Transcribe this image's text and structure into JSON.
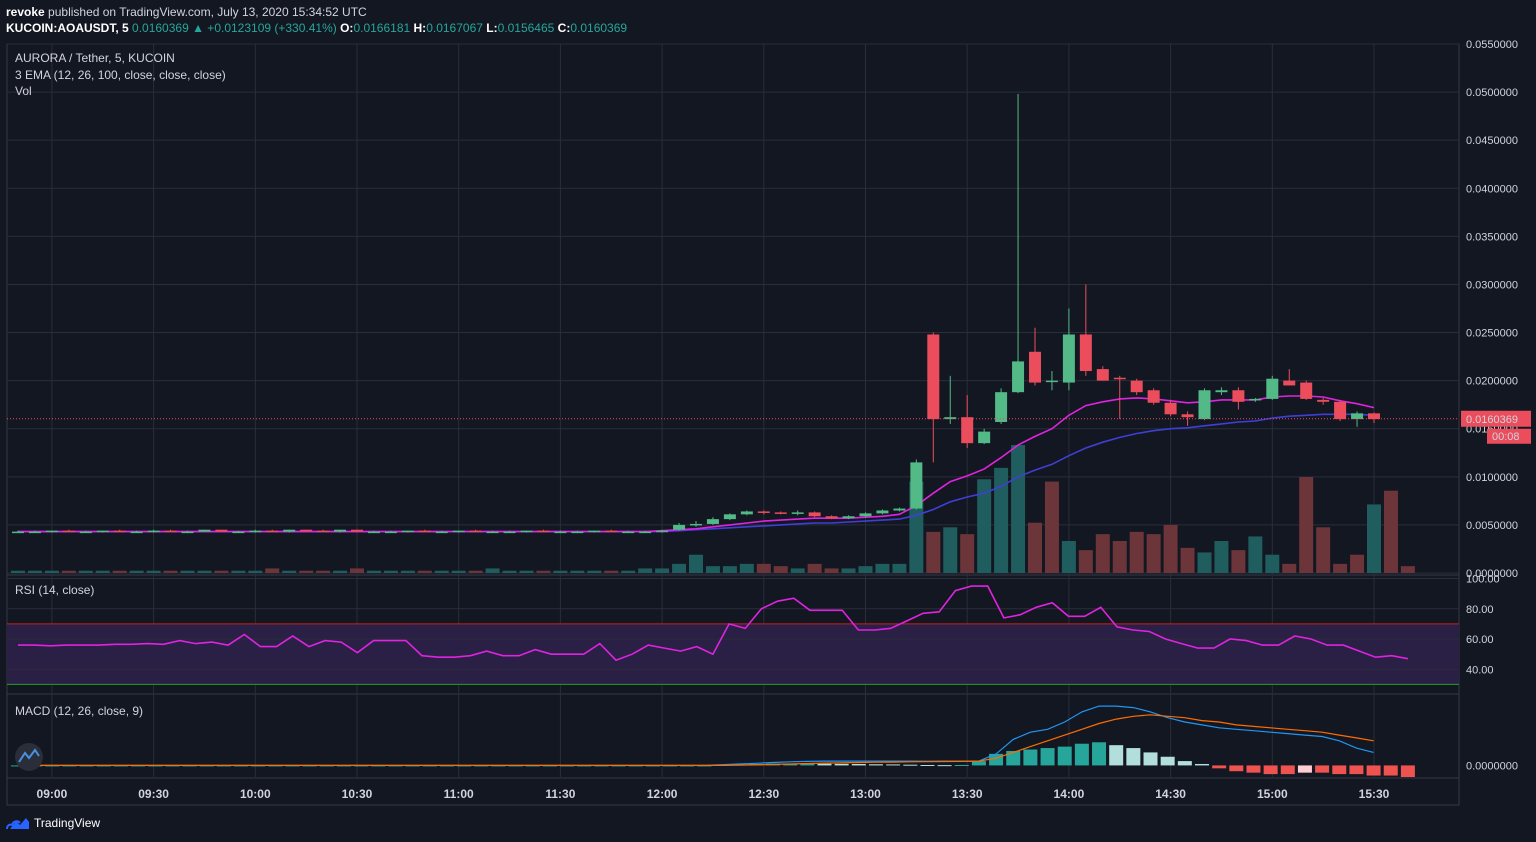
{
  "header": {
    "author": "revoke",
    "published_text": "published on TradingView.com, July 13, 2020 15:34:52 UTC",
    "symbol": "KUCOIN:AOAUSDT, 5",
    "last": "0.0160369",
    "change": "▲ +0.0123109 (+330.41%)",
    "o_label": "O:",
    "o_value": "0.0166181",
    "h_label": "H:",
    "h_value": "0.0167067",
    "l_label": "L:",
    "l_value": "0.0156465",
    "c_label": "C:",
    "c_value": "0.0160369"
  },
  "price_pane": {
    "title": "AURORA / Tether, 5, KUCOIN",
    "ema_label": "3 EMA (12, 26, 100, close, close, close)",
    "vol_label": "Vol",
    "price_tag": "0.0160369",
    "countdown": "00:08"
  },
  "rsi_pane": {
    "label": "RSI (14, close)"
  },
  "macd_pane": {
    "label": "MACD (12, 26, close, 9)"
  },
  "footer": {
    "brand": "TradingView"
  },
  "colors": {
    "up": "#53b987",
    "down": "#eb4d5c",
    "vol_up": "#1f5d5e",
    "vol_down": "#6c3539",
    "ema_fast": "#e023e0",
    "ema_slow": "#3f3fd6",
    "rsi": "#e023e0",
    "macd": "#2196f3",
    "signal": "#ff6d00"
  },
  "chart_data": [
    {
      "type": "candlestick",
      "ylim": [
        0,
        0.055
      ],
      "y_ticks": [
        "0.0550000",
        "0.0500000",
        "0.0450000",
        "0.0400000",
        "0.0350000",
        "0.0300000",
        "0.0250000",
        "0.0200000",
        "0.0150000",
        "0.0100000",
        "0.0050000",
        "0.0000000"
      ],
      "y_tick_values": [
        0.055,
        0.05,
        0.045,
        0.04,
        0.035,
        0.03,
        0.025,
        0.02,
        0.015,
        0.01,
        0.005,
        0
      ],
      "x_ticks": [
        "09:00",
        "09:30",
        "10:00",
        "10:30",
        "11:00",
        "11:30",
        "12:00",
        "12:30",
        "13:00",
        "13:30",
        "14:00",
        "14:30",
        "15:00",
        "15:30"
      ],
      "x_tick_index": [
        2,
        8,
        14,
        20,
        26,
        32,
        38,
        44,
        50,
        56,
        62,
        68,
        74,
        80
      ],
      "ohlc": [
        [
          0.0043,
          0.0044,
          0.0042,
          0.0043
        ],
        [
          0.0043,
          0.0044,
          0.0042,
          0.0043
        ],
        [
          0.0043,
          0.0044,
          0.0042,
          0.0044
        ],
        [
          0.0044,
          0.0045,
          0.0043,
          0.0043
        ],
        [
          0.0043,
          0.0044,
          0.0042,
          0.0043
        ],
        [
          0.0043,
          0.0044,
          0.0042,
          0.0044
        ],
        [
          0.0044,
          0.0045,
          0.0043,
          0.0043
        ],
        [
          0.0043,
          0.0044,
          0.0042,
          0.0043
        ],
        [
          0.0043,
          0.0045,
          0.0042,
          0.0044
        ],
        [
          0.0044,
          0.0045,
          0.0043,
          0.0043
        ],
        [
          0.0043,
          0.0044,
          0.0042,
          0.0043
        ],
        [
          0.0043,
          0.0045,
          0.0043,
          0.0045
        ],
        [
          0.0045,
          0.0045,
          0.0043,
          0.0043
        ],
        [
          0.0043,
          0.0044,
          0.0042,
          0.0043
        ],
        [
          0.0043,
          0.0045,
          0.0042,
          0.0044
        ],
        [
          0.0044,
          0.0045,
          0.0043,
          0.0043
        ],
        [
          0.0043,
          0.0045,
          0.0042,
          0.0045
        ],
        [
          0.0045,
          0.0045,
          0.0043,
          0.0044
        ],
        [
          0.0044,
          0.0045,
          0.0043,
          0.0043
        ],
        [
          0.0043,
          0.0045,
          0.0042,
          0.0045
        ],
        [
          0.0045,
          0.0045,
          0.0043,
          0.0043
        ],
        [
          0.0043,
          0.0044,
          0.0042,
          0.0043
        ],
        [
          0.0043,
          0.0044,
          0.0042,
          0.0043
        ],
        [
          0.0043,
          0.0044,
          0.0042,
          0.0044
        ],
        [
          0.0044,
          0.0045,
          0.0043,
          0.0043
        ],
        [
          0.0043,
          0.0044,
          0.0042,
          0.0043
        ],
        [
          0.0043,
          0.0044,
          0.0042,
          0.0044
        ],
        [
          0.0044,
          0.0045,
          0.0043,
          0.0043
        ],
        [
          0.0043,
          0.0044,
          0.0042,
          0.0043
        ],
        [
          0.0043,
          0.0044,
          0.0042,
          0.0043
        ],
        [
          0.0043,
          0.0044,
          0.0042,
          0.0044
        ],
        [
          0.0044,
          0.0045,
          0.0043,
          0.0043
        ],
        [
          0.0043,
          0.0044,
          0.0042,
          0.0043
        ],
        [
          0.0043,
          0.0044,
          0.0042,
          0.0043
        ],
        [
          0.0043,
          0.0044,
          0.0042,
          0.0044
        ],
        [
          0.0044,
          0.0045,
          0.0043,
          0.0043
        ],
        [
          0.0043,
          0.0044,
          0.0042,
          0.0043
        ],
        [
          0.0043,
          0.0044,
          0.0042,
          0.0043
        ],
        [
          0.0043,
          0.0045,
          0.0042,
          0.0044
        ],
        [
          0.0045,
          0.0052,
          0.0044,
          0.005
        ],
        [
          0.005,
          0.0054,
          0.0048,
          0.0051
        ],
        [
          0.0051,
          0.0058,
          0.005,
          0.0056
        ],
        [
          0.0056,
          0.0062,
          0.0055,
          0.0061
        ],
        [
          0.0061,
          0.0065,
          0.006,
          0.0064
        ],
        [
          0.0064,
          0.0065,
          0.0061,
          0.0063
        ],
        [
          0.0063,
          0.0064,
          0.0061,
          0.0062
        ],
        [
          0.0062,
          0.0065,
          0.006,
          0.0063
        ],
        [
          0.0063,
          0.0064,
          0.0058,
          0.0059
        ],
        [
          0.0059,
          0.006,
          0.0056,
          0.0057
        ],
        [
          0.0057,
          0.006,
          0.0056,
          0.0059
        ],
        [
          0.0059,
          0.0063,
          0.0058,
          0.0062
        ],
        [
          0.0062,
          0.0066,
          0.0061,
          0.0065
        ],
        [
          0.0065,
          0.0068,
          0.0064,
          0.0067
        ],
        [
          0.0067,
          0.0118,
          0.0066,
          0.0115
        ],
        [
          0.0248,
          0.025,
          0.0115,
          0.016
        ],
        [
          0.016,
          0.0205,
          0.0155,
          0.0162
        ],
        [
          0.0162,
          0.0185,
          0.013,
          0.0135
        ],
        [
          0.0135,
          0.015,
          0.0134,
          0.0147
        ],
        [
          0.0157,
          0.0192,
          0.0155,
          0.0188
        ],
        [
          0.0188,
          0.0498,
          0.0187,
          0.022
        ],
        [
          0.023,
          0.0255,
          0.0195,
          0.0198
        ],
        [
          0.02,
          0.021,
          0.019,
          0.02
        ],
        [
          0.0198,
          0.0275,
          0.019,
          0.0248
        ],
        [
          0.0248,
          0.03,
          0.0205,
          0.021
        ],
        [
          0.0212,
          0.0215,
          0.02,
          0.02
        ],
        [
          0.0203,
          0.0205,
          0.016,
          0.0202
        ],
        [
          0.02,
          0.0202,
          0.0185,
          0.0188
        ],
        [
          0.019,
          0.0192,
          0.0175,
          0.0177
        ],
        [
          0.0177,
          0.018,
          0.0163,
          0.0165
        ],
        [
          0.0165,
          0.0168,
          0.0153,
          0.0162
        ],
        [
          0.016,
          0.0192,
          0.0159,
          0.019
        ],
        [
          0.0188,
          0.0193,
          0.0185,
          0.019
        ],
        [
          0.019,
          0.0193,
          0.017,
          0.0178
        ],
        [
          0.018,
          0.0182,
          0.0178,
          0.0181
        ],
        [
          0.0181,
          0.0205,
          0.018,
          0.0202
        ],
        [
          0.02,
          0.0212,
          0.0195,
          0.0195
        ],
        [
          0.0198,
          0.02,
          0.018,
          0.0181
        ],
        [
          0.018,
          0.0182,
          0.0175,
          0.0178
        ],
        [
          0.0178,
          0.018,
          0.0158,
          0.016
        ],
        [
          0.016,
          0.0168,
          0.0152,
          0.0166
        ],
        [
          0.0166,
          0.0167,
          0.0156,
          0.016
        ]
      ],
      "ema_fast": [
        0.0043,
        0.0043,
        0.0043,
        0.0043,
        0.0043,
        0.0043,
        0.0043,
        0.0043,
        0.0043,
        0.0043,
        0.0043,
        0.0043,
        0.0043,
        0.0043,
        0.0043,
        0.0043,
        0.0043,
        0.0043,
        0.0043,
        0.0043,
        0.0043,
        0.0043,
        0.0043,
        0.0043,
        0.0043,
        0.0043,
        0.0043,
        0.0043,
        0.0043,
        0.0043,
        0.0043,
        0.0043,
        0.0043,
        0.0043,
        0.0043,
        0.0043,
        0.0043,
        0.0043,
        0.0044,
        0.0045,
        0.0046,
        0.0048,
        0.005,
        0.0052,
        0.0054,
        0.0055,
        0.0056,
        0.0057,
        0.0057,
        0.0057,
        0.0058,
        0.0059,
        0.0061,
        0.007,
        0.0083,
        0.0095,
        0.0101,
        0.0108,
        0.012,
        0.0133,
        0.0142,
        0.015,
        0.0164,
        0.0174,
        0.0178,
        0.0181,
        0.0182,
        0.0181,
        0.0179,
        0.0177,
        0.0178,
        0.018,
        0.018,
        0.018,
        0.0183,
        0.0184,
        0.0184,
        0.0183,
        0.0179,
        0.0176,
        0.0172
      ],
      "ema_slow": [
        0.0043,
        0.0043,
        0.0043,
        0.0043,
        0.0043,
        0.0043,
        0.0043,
        0.0043,
        0.0043,
        0.0043,
        0.0043,
        0.0043,
        0.0043,
        0.0043,
        0.0043,
        0.0043,
        0.0043,
        0.0043,
        0.0043,
        0.0043,
        0.0043,
        0.0043,
        0.0043,
        0.0043,
        0.0043,
        0.0043,
        0.0043,
        0.0043,
        0.0043,
        0.0043,
        0.0043,
        0.0043,
        0.0043,
        0.0043,
        0.0043,
        0.0043,
        0.0043,
        0.0043,
        0.0043,
        0.0044,
        0.0045,
        0.0046,
        0.0047,
        0.0048,
        0.0049,
        0.005,
        0.0051,
        0.0052,
        0.0052,
        0.0053,
        0.0054,
        0.0055,
        0.0056,
        0.006,
        0.0066,
        0.0074,
        0.0079,
        0.0083,
        0.009,
        0.01,
        0.0107,
        0.0113,
        0.0122,
        0.013,
        0.0136,
        0.0141,
        0.0145,
        0.0148,
        0.015,
        0.0151,
        0.0153,
        0.0155,
        0.0157,
        0.0158,
        0.0161,
        0.0163,
        0.0164,
        0.0165,
        0.0165,
        0.0165,
        0.0164
      ],
      "volume": [
        1,
        1,
        1,
        1,
        1,
        1,
        1,
        1,
        1,
        1,
        1,
        1,
        1,
        1,
        1,
        2,
        1,
        1,
        1,
        1,
        2,
        1,
        1,
        1,
        1,
        1,
        1,
        1,
        2,
        1,
        1,
        1,
        1,
        1,
        1,
        1,
        1,
        2,
        2,
        4,
        8,
        3,
        3,
        4,
        4,
        3,
        2,
        4,
        2,
        2,
        3,
        4,
        4,
        40,
        18,
        20,
        17,
        41,
        46,
        56,
        22,
        40,
        14,
        10,
        17,
        14,
        18,
        17,
        21,
        11,
        9,
        14,
        10,
        16,
        8,
        4,
        42,
        20,
        4,
        8,
        30,
        36,
        3
      ],
      "volume_up": [
        true,
        true,
        true,
        false,
        true,
        true,
        false,
        true,
        true,
        false,
        true,
        true,
        false,
        true,
        true,
        false,
        true,
        false,
        false,
        true,
        false,
        true,
        true,
        true,
        false,
        true,
        true,
        false,
        true,
        true,
        true,
        false,
        true,
        true,
        true,
        false,
        true,
        true,
        true,
        true,
        true,
        true,
        true,
        true,
        false,
        false,
        true,
        false,
        false,
        true,
        true,
        true,
        true,
        true,
        false,
        true,
        false,
        true,
        true,
        true,
        false,
        false,
        true,
        false,
        false,
        false,
        false,
        false,
        false,
        false,
        true,
        true,
        false,
        true,
        true,
        false,
        false,
        false,
        false,
        false,
        true,
        false
      ]
    },
    {
      "type": "line",
      "name": "RSI (14, close)",
      "ylim": [
        25,
        101
      ],
      "y_ticks": [
        "100.00",
        "80.00",
        "60.00",
        "40.00"
      ],
      "y_tick_values": [
        100,
        80,
        60,
        40
      ],
      "bands": [
        30,
        70
      ],
      "values": [
        56,
        56,
        55.5,
        56,
        56,
        56,
        56.5,
        56.5,
        57,
        56.5,
        59,
        57,
        58,
        56,
        63,
        55,
        55,
        62,
        55,
        59,
        58,
        51,
        59,
        59,
        59,
        49,
        48,
        48,
        49,
        52,
        49,
        49,
        53,
        50,
        50,
        50,
        57,
        46,
        50,
        56,
        54,
        52,
        55,
        50,
        70,
        67,
        80,
        85,
        87,
        79,
        79,
        79,
        66,
        66,
        67,
        72,
        77,
        78,
        92,
        95,
        95,
        74,
        76,
        81,
        84,
        75,
        75,
        81,
        68,
        66,
        65,
        60,
        57,
        54,
        54,
        60,
        59,
        56,
        56,
        62,
        60,
        56,
        56,
        52,
        48,
        49,
        47
      ]
    },
    {
      "type": "line",
      "name": "MACD (12, 26, close, 9)",
      "ylim": [
        -0.0008,
        0.0048
      ],
      "y_ticks": [
        "0.0000000"
      ],
      "y_tick_values": [
        0
      ],
      "macd": [
        0,
        0,
        0,
        0,
        0,
        0,
        0,
        0,
        0,
        0,
        0,
        0,
        0,
        0,
        0,
        0,
        0,
        0,
        0,
        0,
        0,
        0,
        0,
        0,
        0,
        0,
        0,
        0,
        0,
        0,
        0,
        0,
        0,
        0,
        0,
        0,
        0,
        0,
        0,
        0,
        0,
        5e-05,
        0.0001,
        0.00015,
        0.0002,
        0.00025,
        0.00028,
        0.0003,
        0.0003,
        0.0003,
        0.0003,
        0.0003,
        0.0003,
        0.00029,
        0.0003,
        0.0003,
        0.0003,
        0.0008,
        0.0018,
        0.0023,
        0.0025,
        0.003,
        0.0037,
        0.0041,
        0.0041,
        0.004,
        0.0037,
        0.0033,
        0.003,
        0.0028,
        0.0026,
        0.0025,
        0.0024,
        0.0023,
        0.0022,
        0.0021,
        0.002,
        0.0017,
        0.0012,
        0.0009
      ],
      "signal": [
        0,
        0,
        0,
        0,
        0,
        0,
        0,
        0,
        0,
        0,
        0,
        0,
        0,
        0,
        0,
        0,
        0,
        0,
        0,
        0,
        0,
        0,
        0,
        0,
        0,
        0,
        0,
        0,
        0,
        0,
        0,
        0,
        0,
        0,
        0,
        0,
        0,
        0,
        0,
        0,
        0,
        0,
        2e-05,
        4e-05,
        7e-05,
        0.0001,
        0.00013,
        0.00016,
        0.00018,
        0.0002,
        0.00022,
        0.00023,
        0.00025,
        0.00026,
        0.00027,
        0.00028,
        0.0003,
        0.0005,
        0.0009,
        0.0013,
        0.0017,
        0.0021,
        0.0025,
        0.0029,
        0.0032,
        0.0034,
        0.0035,
        0.0034,
        0.0033,
        0.0031,
        0.003,
        0.0028,
        0.0027,
        0.0026,
        0.0025,
        0.0024,
        0.0023,
        0.0021,
        0.0019,
        0.0017
      ],
      "histogram": [
        0,
        0,
        0,
        0,
        0,
        0,
        0,
        0,
        0,
        0,
        0,
        0,
        0,
        0,
        0,
        0,
        0,
        0,
        0,
        0,
        0,
        0,
        0,
        0,
        0,
        0,
        0,
        0,
        0,
        0,
        0,
        0,
        0,
        0,
        0,
        0,
        0,
        0,
        0,
        0,
        0,
        5e-05,
        8e-05,
        0.0001,
        0.00012,
        0.00013,
        0.00013,
        0.00012,
        0.00011,
        0.0001,
        8e-05,
        7e-05,
        5e-05,
        3e-05,
        2e-05,
        3e-05,
        0.0003,
        0.0008,
        0.001,
        0.0011,
        0.0012,
        0.0013,
        0.0015,
        0.0016,
        0.0014,
        0.0012,
        0.0009,
        0.0006,
        0.0003,
        0.0001,
        -0.0002,
        -0.0004,
        -0.0005,
        -0.0006,
        -0.0006,
        -0.0005,
        -0.0005,
        -0.0006,
        -0.0006,
        -0.0007,
        -0.0007,
        -0.0008
      ]
    }
  ]
}
